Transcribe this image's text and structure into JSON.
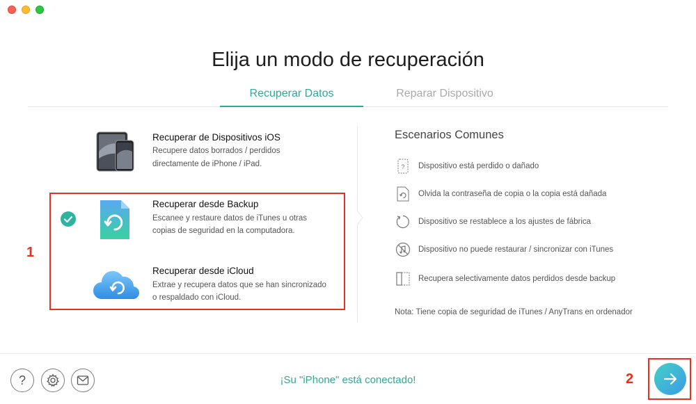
{
  "window": {
    "controls": [
      "close-button",
      "minimize-button",
      "zoom-button"
    ]
  },
  "header": {
    "title": "Elija un modo de recuperación"
  },
  "tabs": [
    {
      "label": "Recuperar Datos",
      "active": true
    },
    {
      "label": "Reparar Dispositivo",
      "active": false
    }
  ],
  "options": [
    {
      "title": "Recuperar de Dispositivos iOS",
      "desc_line1": "Recupere datos borrados / perdidos",
      "desc_line2": "directamente de iPhone / iPad.",
      "icon": "devices-icon"
    },
    {
      "title": "Recuperar desde Backup",
      "desc_line1": "Escanee y restaure datos de iTunes u otras",
      "desc_line2": "copias de seguridad en la computadora.",
      "icon": "backup-icon",
      "selected": true
    },
    {
      "title": "Recuperar desde iCloud",
      "desc_line1": "Extrae y recupera datos que se han sincronizado",
      "desc_line2": "o respaldado con iCloud.",
      "icon": "icloud-icon"
    }
  ],
  "annotations": {
    "step1": "1",
    "step2": "2"
  },
  "scenarios": {
    "title": "Escenarios Comunes",
    "items": [
      {
        "text": "Dispositivo está perdido o dañado",
        "icon": "question-device-icon"
      },
      {
        "text": "Olvida la contraseña de copia o la copia está dañada",
        "icon": "backup-file-icon"
      },
      {
        "text": "Dispositivo se restablece a los ajustes de fábrica",
        "icon": "reset-icon"
      },
      {
        "text": "Dispositivo no puede restaurar / sincronizar con iTunes",
        "icon": "no-sync-icon"
      },
      {
        "text": "Recupera selectivamente datos perdidos desde backup",
        "icon": "selective-icon"
      }
    ],
    "note": "Nota: Tiene copia de seguridad de iTunes / AnyTrans en ordenador"
  },
  "footer": {
    "status": "¡Su \"iPhone\" está conectado!",
    "help_glyph": "?"
  },
  "colors": {
    "accent": "#2fa897",
    "annotation_red": "#e8301e",
    "next_gradient_start": "#45d0c4",
    "next_gradient_end": "#3b9be8"
  }
}
